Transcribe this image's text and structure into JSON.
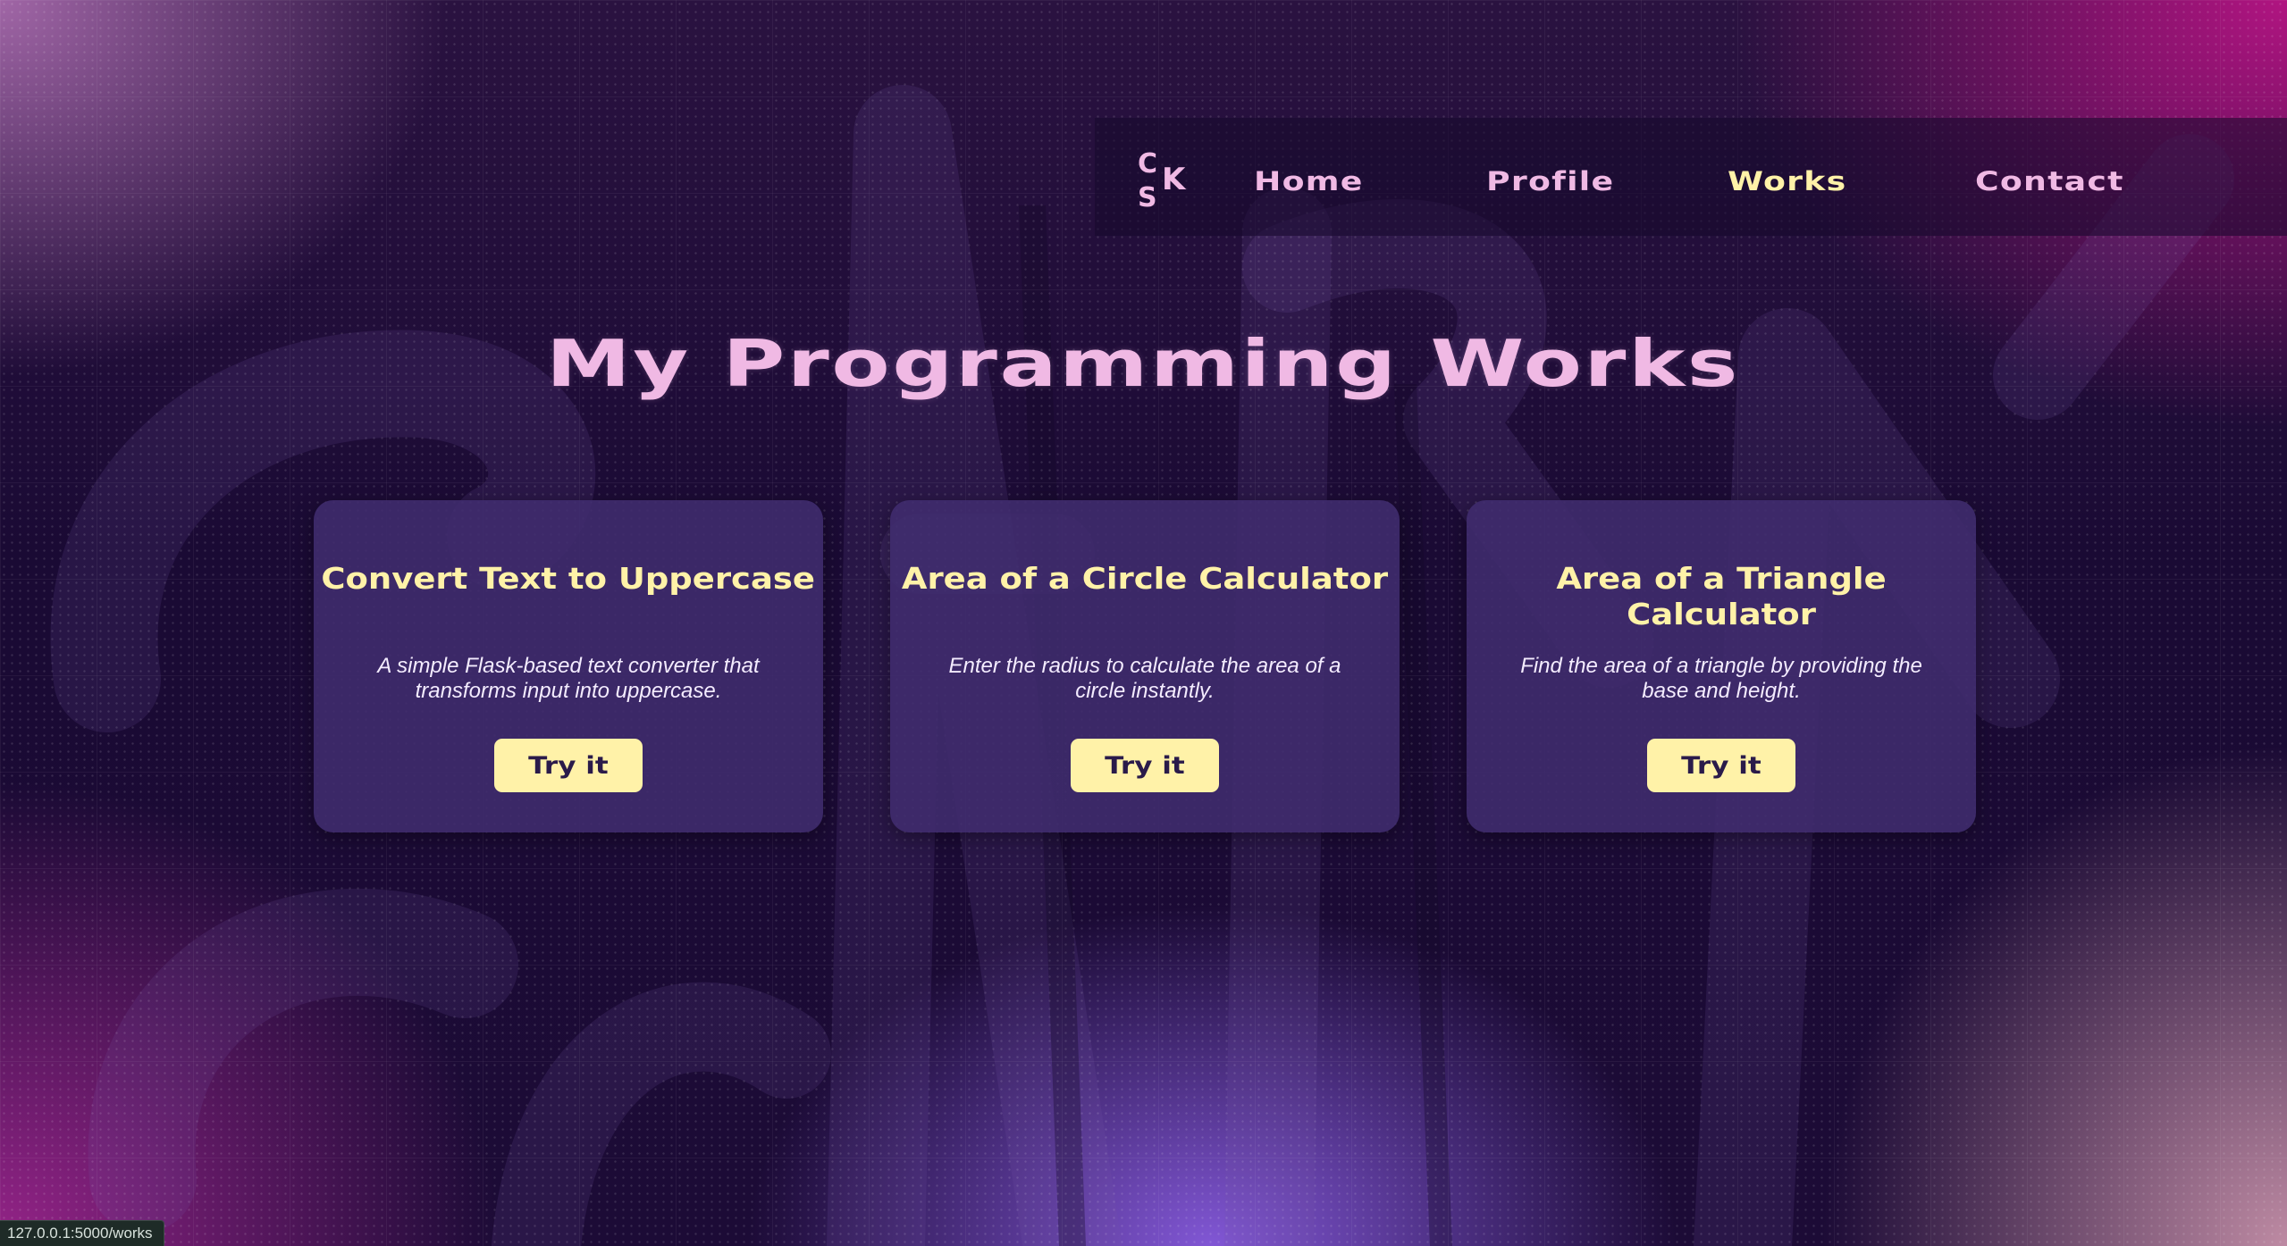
{
  "nav": {
    "logo_letters": [
      "C",
      "S",
      "K"
    ],
    "links": [
      {
        "label": "Home"
      },
      {
        "label": "Profile"
      },
      {
        "label": "Works",
        "active": true
      },
      {
        "label": "Contact"
      }
    ]
  },
  "main": {
    "title": "My Programming Works",
    "cards": [
      {
        "title": "Convert Text to Uppercase",
        "description": "A simple Flask-based text converter that transforms input into uppercase.",
        "button_label": "Try it"
      },
      {
        "title": "Area of a Circle Calculator",
        "description": "Enter the radius to calculate the area of a circle instantly.",
        "button_label": "Try it"
      },
      {
        "title": "Area of a Triangle Calculator",
        "description": "Find the area of a triangle by providing the base and height.",
        "button_label": "Try it"
      }
    ]
  },
  "status_bar": {
    "url": "127.0.0.1:5000/works"
  },
  "colors": {
    "accent_pink": "#f0b9e4",
    "accent_yellow": "#fff2a8",
    "card_bg": "#402c6e",
    "page_bg": "#180a32"
  }
}
